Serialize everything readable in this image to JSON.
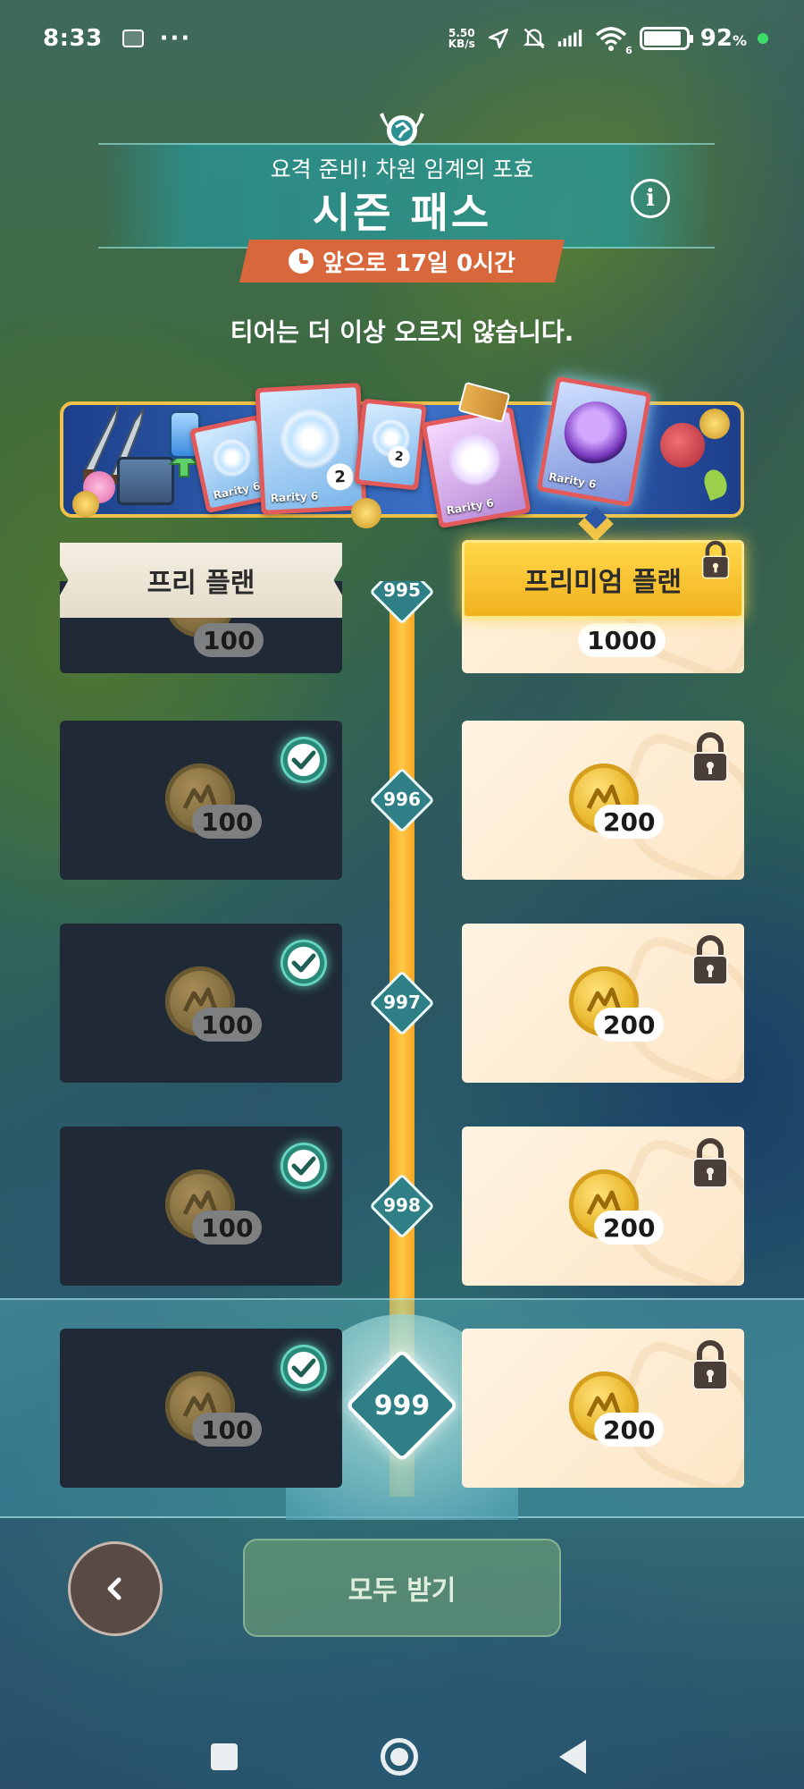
{
  "status_bar": {
    "time": "8:33",
    "dots": "···",
    "speed_value": "5.50",
    "speed_unit": "KB/s",
    "signal_sub": "6",
    "battery": "92",
    "battery_unit": "%"
  },
  "header": {
    "subtitle": "요격 준비! 차원 임계의 포효",
    "title": "시즌 패스",
    "info_label": "i",
    "timer": "앞으로 17일 0시간"
  },
  "notice": "티어는 더 이상 오르지 않습니다.",
  "banner": {
    "cards": [
      {
        "label": "Rarity 6",
        "count": "2"
      },
      {
        "label": "Rarity 6",
        "count": "2"
      },
      {
        "label": "Rarity 6",
        "count": ""
      },
      {
        "label": "Rarity 6",
        "count": ""
      },
      {
        "label": "Rarity 6",
        "count": ""
      }
    ]
  },
  "columns": {
    "free": "프리 플랜",
    "premium": "프리미엄 플랜"
  },
  "tiers": [
    {
      "tier": "995",
      "free_amount": "100",
      "premium_amount": "1000",
      "free_claimed": true,
      "premium_locked": true
    },
    {
      "tier": "996",
      "free_amount": "100",
      "premium_amount": "200",
      "free_claimed": true,
      "premium_locked": true
    },
    {
      "tier": "997",
      "free_amount": "100",
      "premium_amount": "200",
      "free_claimed": true,
      "premium_locked": true
    },
    {
      "tier": "998",
      "free_amount": "100",
      "premium_amount": "200",
      "free_claimed": true,
      "premium_locked": true
    },
    {
      "tier": "999",
      "free_amount": "100",
      "premium_amount": "200",
      "free_claimed": true,
      "premium_locked": true
    }
  ],
  "buttons": {
    "back": "‹",
    "claim_all": "모두 받기"
  },
  "colors": {
    "track": "#f5a622",
    "premium_header": "#f2b11e",
    "timer_bg": "#d8683c",
    "claimed_check": "#66d6c2",
    "free_cell": "#1f2a36"
  }
}
